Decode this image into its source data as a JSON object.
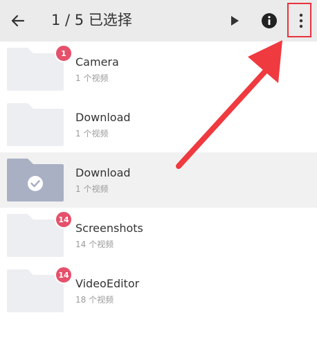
{
  "header": {
    "title": "1 / 5 已选择",
    "back_icon": "arrow-left-icon",
    "play_icon": "play-icon",
    "info_icon": "info-icon",
    "more_icon": "more-vertical-icon"
  },
  "colors": {
    "toolbar_bg": "#ebebeb",
    "folder": "#eceef1",
    "folder_selected": "#a9b0c4",
    "badge": "#e5506a",
    "highlight": "#e8323c"
  },
  "folders": [
    {
      "name": "Camera",
      "count": "1 个视频",
      "badge": "1",
      "selected": false
    },
    {
      "name": "Download",
      "count": "1 个视频",
      "badge": "",
      "selected": false
    },
    {
      "name": "Download",
      "count": "1 个视频",
      "badge": "",
      "selected": true
    },
    {
      "name": "Screenshots",
      "count": "14 个视频",
      "badge": "14",
      "selected": false
    },
    {
      "name": "VideoEditor",
      "count": "18 个视频",
      "badge": "14",
      "selected": false
    }
  ]
}
